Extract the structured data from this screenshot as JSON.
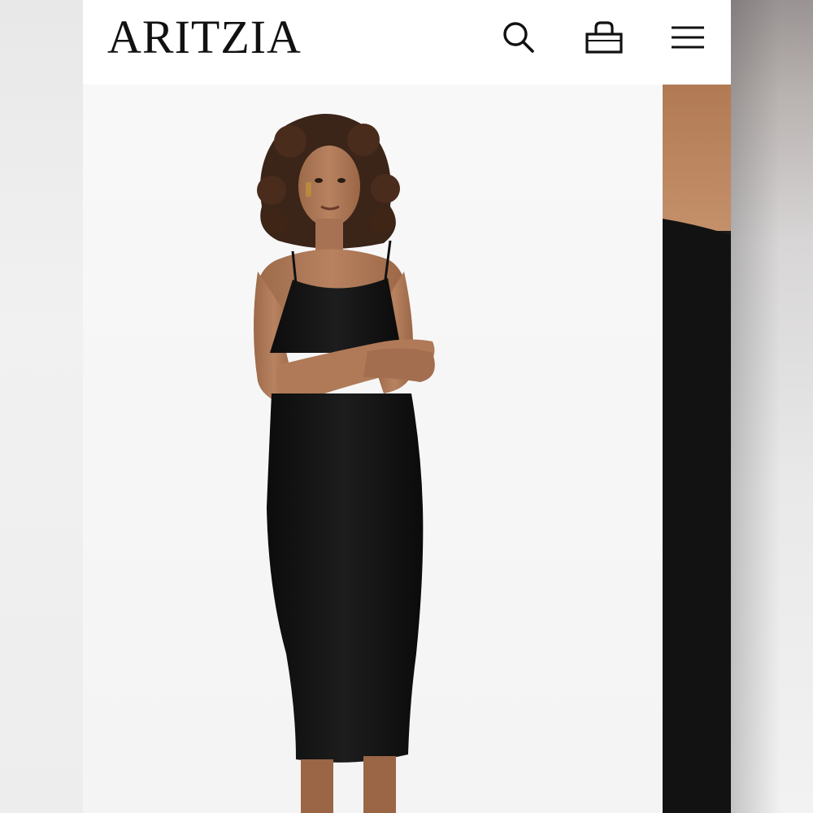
{
  "header": {
    "brand": "ARITZIA",
    "icons": [
      "search-icon",
      "shopping-bag-icon",
      "hamburger-menu-icon"
    ]
  },
  "product_gallery": {
    "main_image": "model-in-black-midi-slip-dress",
    "side_thumbnail": "fabric-detail-close-up",
    "colors": {
      "dress": "#111111",
      "skin": "#b07a58",
      "background": "#f6f6f6"
    }
  }
}
